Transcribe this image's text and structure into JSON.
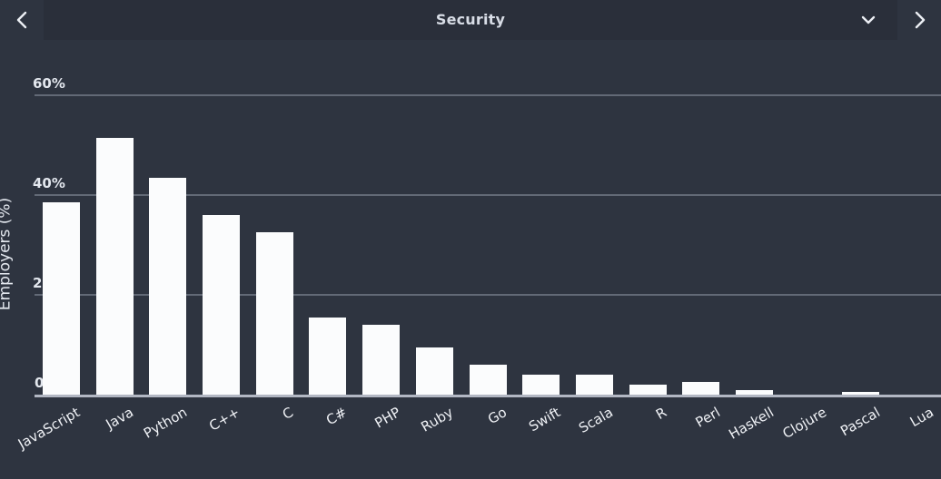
{
  "header": {
    "title": "Security",
    "prev_icon": "chevron-left-icon",
    "next_icon": "chevron-right-icon",
    "dropdown_icon": "chevron-down-icon"
  },
  "colors": {
    "background": "#2e3440",
    "header_panel": "#2a2f3a",
    "bar": "#fbfcfd",
    "gridline": "#8e95a3",
    "baseline": "#c9cfdb",
    "text": "#e3e7ee"
  },
  "chart_data": {
    "type": "bar",
    "title": "Security",
    "xlabel": "",
    "ylabel": "Employers (%)",
    "ylim": [
      0,
      60
    ],
    "yticks": [
      0,
      20,
      40,
      60
    ],
    "ytick_labels": [
      "0",
      "20%",
      "40%",
      "60%"
    ],
    "grid": true,
    "legend": "none",
    "categories": [
      "JavaScript",
      "Java",
      "Python",
      "C++",
      "C",
      "C#",
      "PHP",
      "Ruby",
      "Go",
      "Swift",
      "Scala",
      "R",
      "Perl",
      "Haskell",
      "Clojure",
      "Pascal",
      "Lua"
    ],
    "values": [
      38.5,
      51.5,
      43.5,
      36.0,
      32.5,
      15.5,
      14.0,
      9.5,
      6.0,
      4.0,
      4.0,
      2.0,
      2.5,
      1.0,
      0.0,
      0.5,
      0.0
    ]
  }
}
